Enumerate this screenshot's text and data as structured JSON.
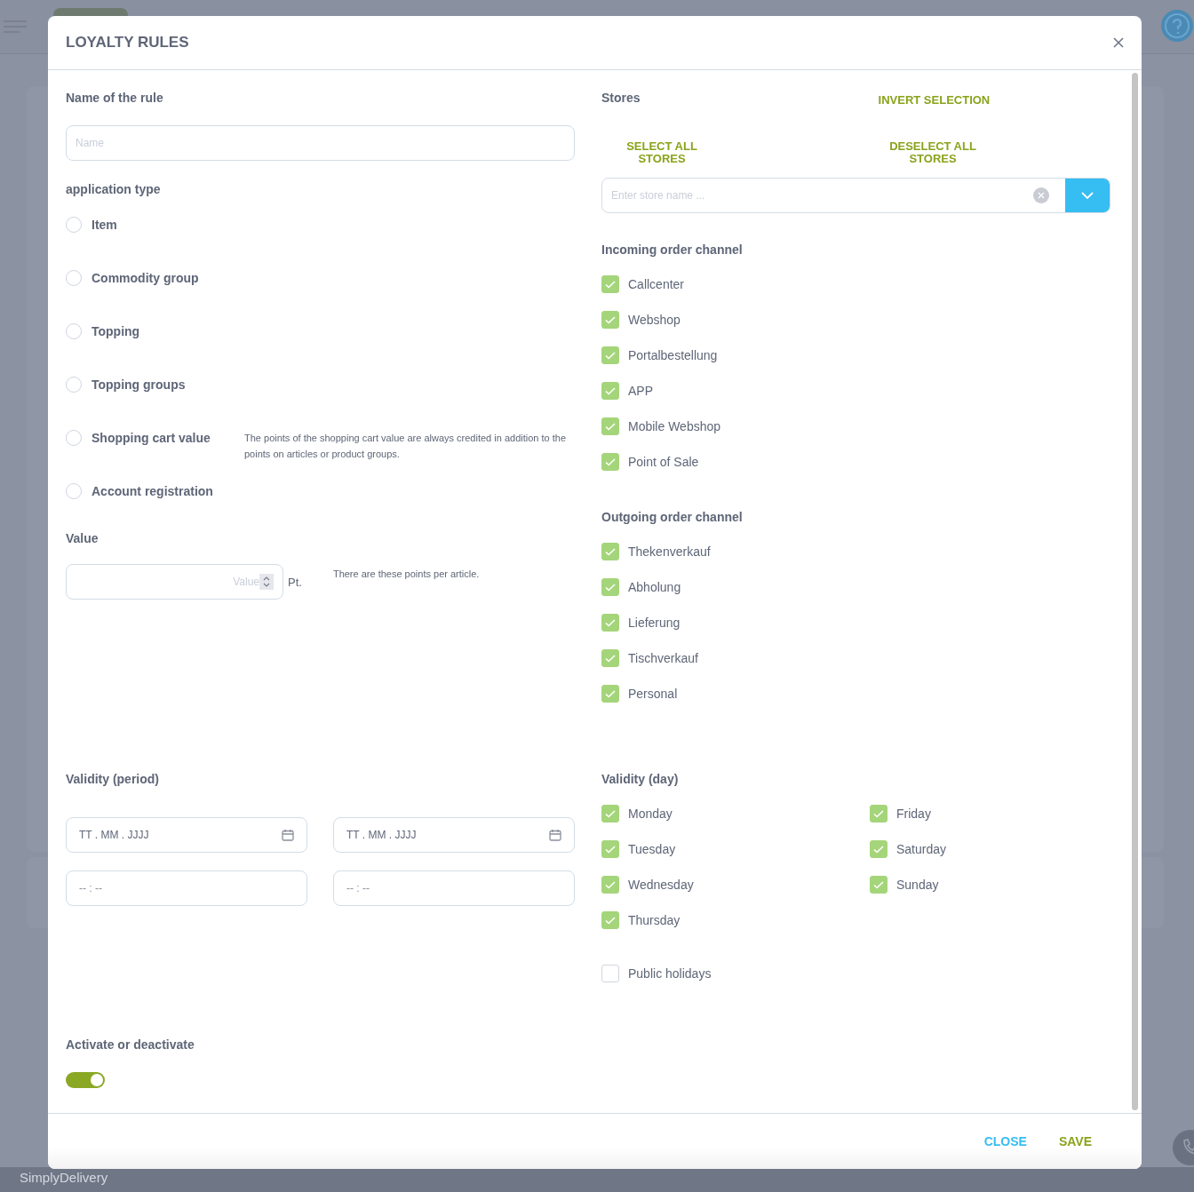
{
  "app": {
    "logo": "SimplyDelivery"
  },
  "dialog": {
    "title": "LOYALTY RULES"
  },
  "name_field": {
    "label": "Name of the rule",
    "placeholder": "Name"
  },
  "application_type": {
    "label": "application type",
    "options": [
      {
        "label": "Item",
        "selected": false
      },
      {
        "label": "Commodity group",
        "selected": false
      },
      {
        "label": "Topping",
        "selected": false
      },
      {
        "label": "Topping groups",
        "selected": false
      },
      {
        "label": "Shopping cart value",
        "selected": false,
        "note": "The points of the shopping cart value are always credited in addition to the points on articles or product groups."
      },
      {
        "label": "Account registration",
        "selected": false
      }
    ]
  },
  "value": {
    "label": "Value",
    "placeholder": "Value",
    "unit": "Pt.",
    "hint": "There are these points per article."
  },
  "stores": {
    "label": "Stores",
    "invert": "INVERT SELECTION",
    "select_all": "SELECT ALL STORES",
    "deselect_all": "DESELECT ALL STORES",
    "search_placeholder": "Enter store name ..."
  },
  "incoming": {
    "label": "Incoming order channel",
    "channels": [
      {
        "label": "Callcenter",
        "checked": true
      },
      {
        "label": "Webshop",
        "checked": true
      },
      {
        "label": "Portalbestellung",
        "checked": true
      },
      {
        "label": "APP",
        "checked": true
      },
      {
        "label": "Mobile Webshop",
        "checked": true
      },
      {
        "label": "Point of Sale",
        "checked": true
      }
    ]
  },
  "outgoing": {
    "label": "Outgoing order channel",
    "channels": [
      {
        "label": "Thekenverkauf",
        "checked": true
      },
      {
        "label": "Abholung",
        "checked": true
      },
      {
        "label": "Lieferung",
        "checked": true
      },
      {
        "label": "Tischverkauf",
        "checked": true
      },
      {
        "label": "Personal",
        "checked": true
      }
    ]
  },
  "validity_period": {
    "label": "Validity (period)",
    "fields": [
      {
        "kind": "date",
        "placeholder": "TT . MM . JJJJ"
      },
      {
        "kind": "date",
        "placeholder": "TT . MM . JJJJ"
      },
      {
        "kind": "time",
        "placeholder": "-- : --"
      },
      {
        "kind": "time",
        "placeholder": "-- : --"
      }
    ]
  },
  "validity_day": {
    "label": "Validity (day)",
    "days": [
      {
        "label": "Monday",
        "checked": true
      },
      {
        "label": "Tuesday",
        "checked": true
      },
      {
        "label": "Wednesday",
        "checked": true
      },
      {
        "label": "Thursday",
        "checked": true
      },
      {
        "label": "Friday",
        "checked": true
      },
      {
        "label": "Saturday",
        "checked": true
      },
      {
        "label": "Sunday",
        "checked": true
      }
    ],
    "public_holidays": {
      "label": "Public holidays",
      "checked": false
    }
  },
  "activation": {
    "label": "Activate or deactivate",
    "on": true
  },
  "buttons": [
    {
      "label": "CLOSE",
      "kind": "close"
    },
    {
      "label": "SAVE",
      "kind": "save"
    }
  ]
}
